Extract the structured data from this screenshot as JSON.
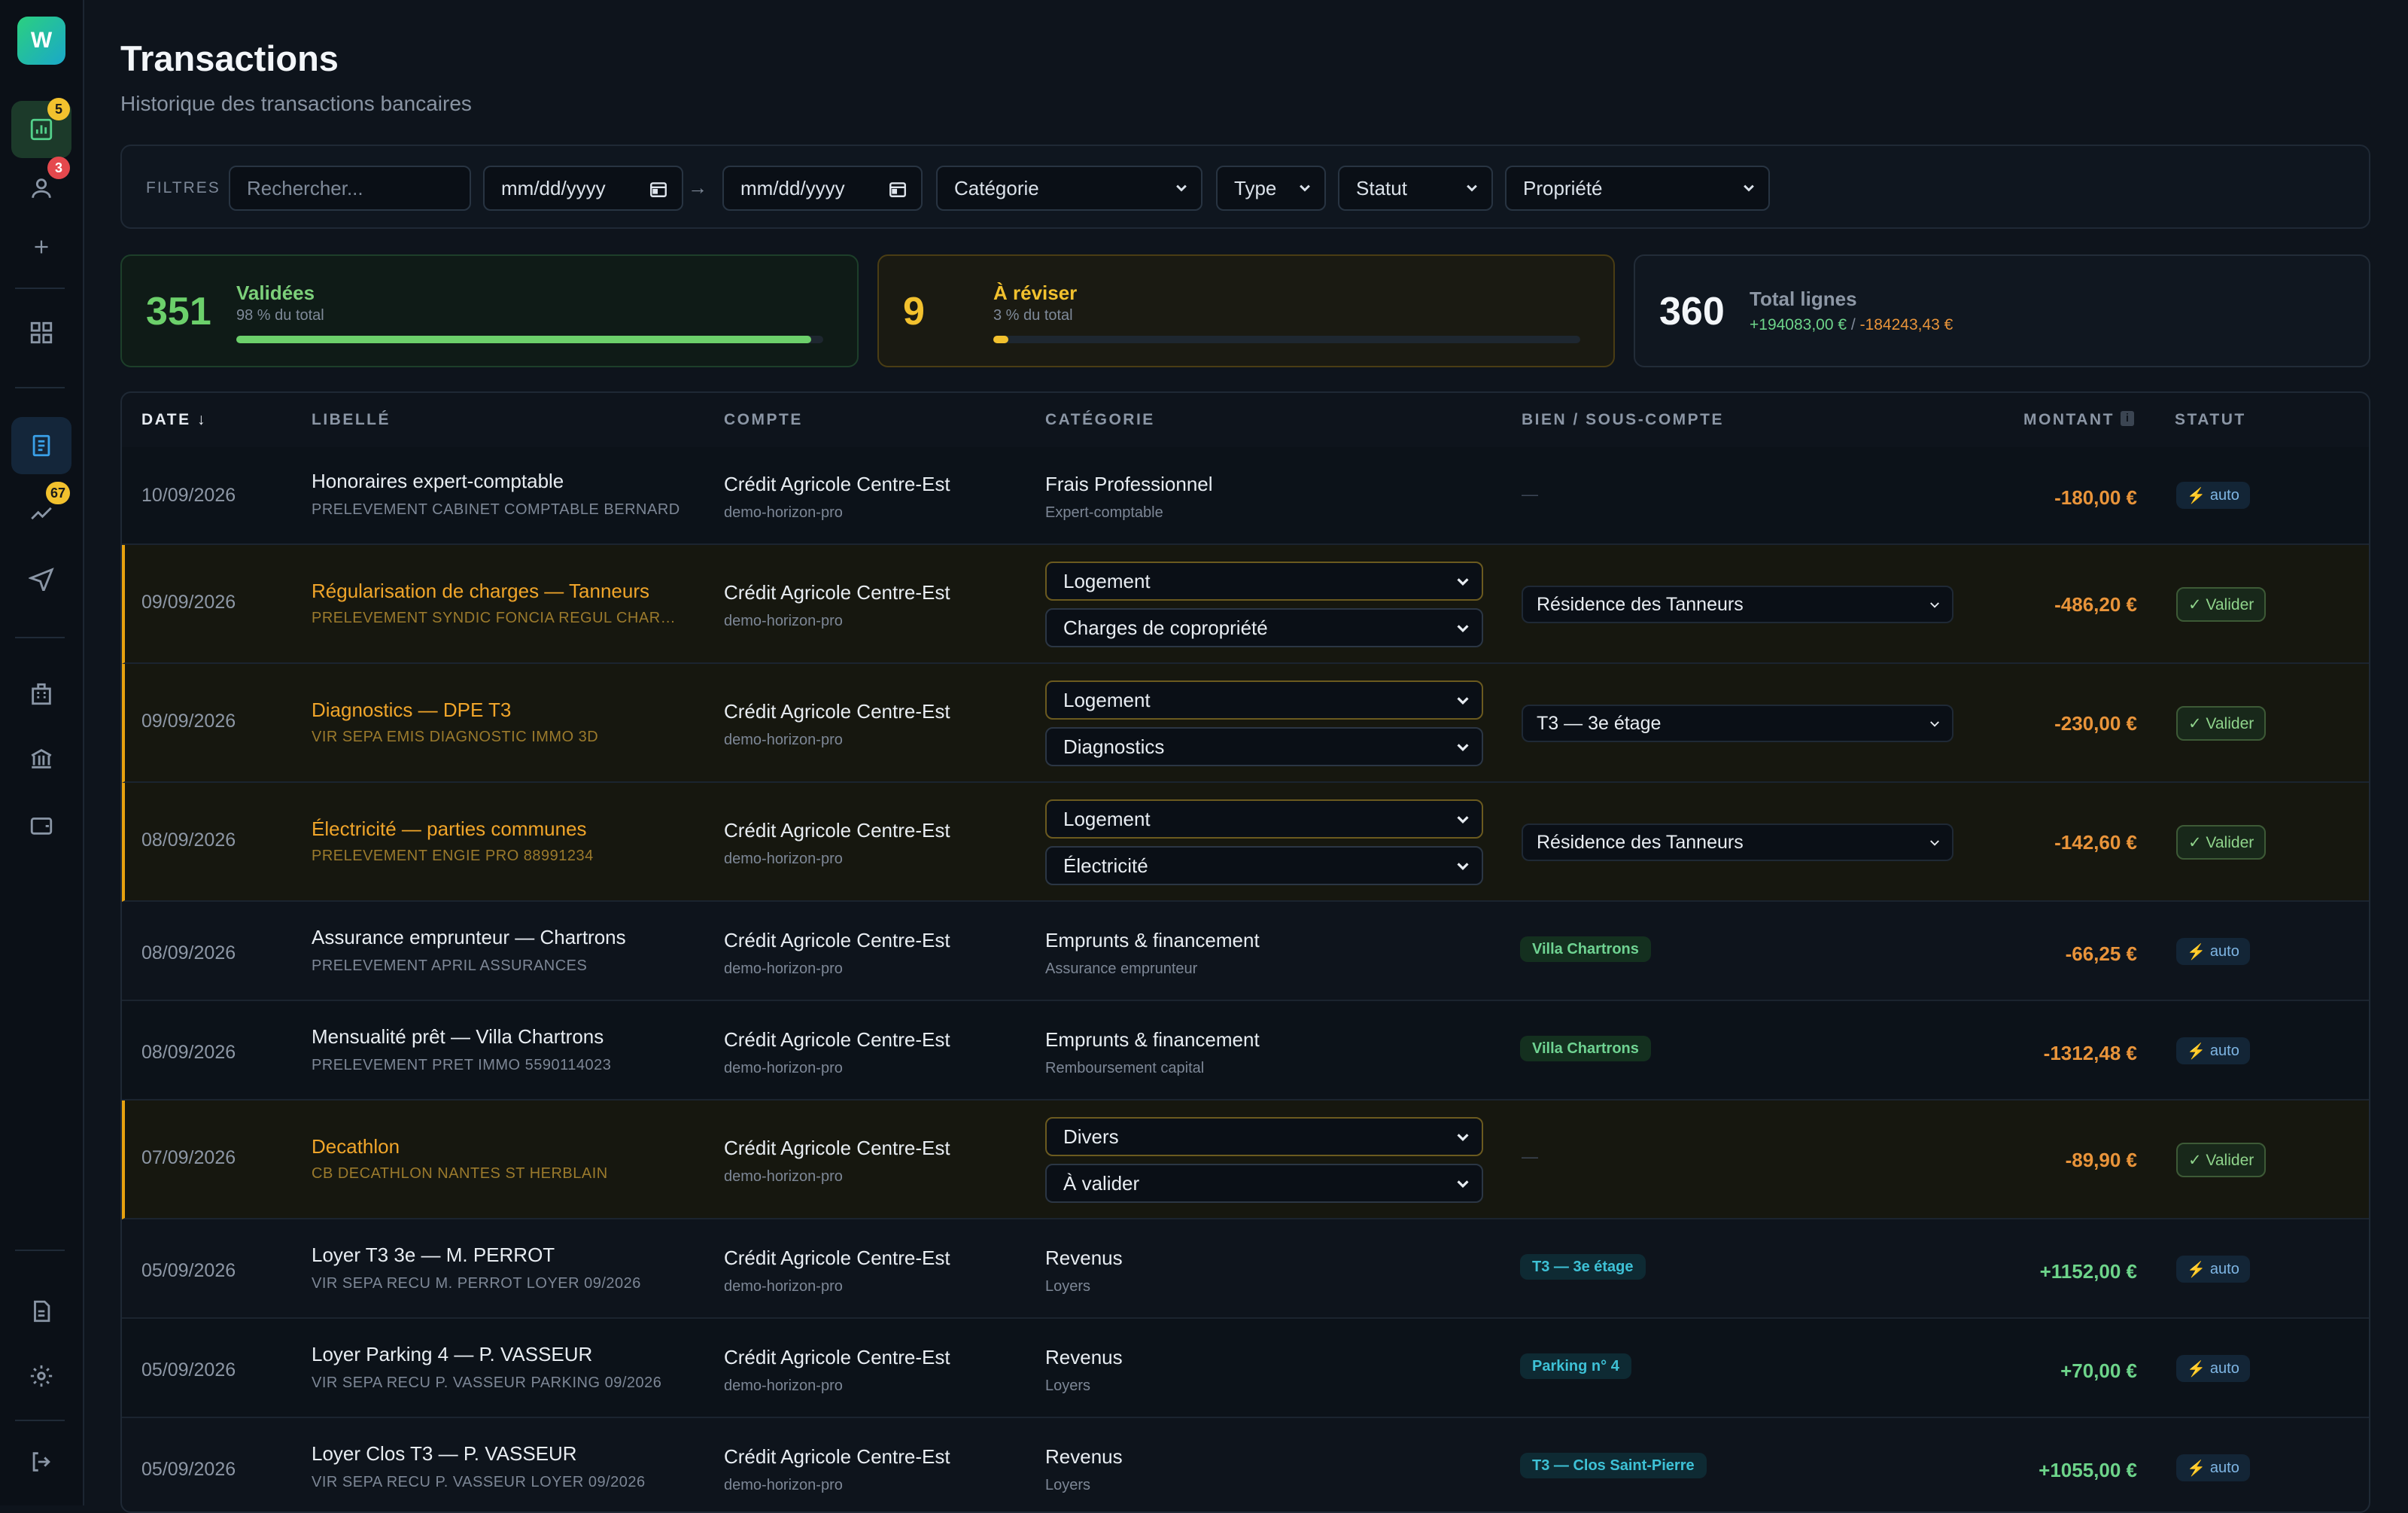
{
  "app": {
    "logo_letter": "W"
  },
  "sidebar": {
    "badges": {
      "dashboard": "5",
      "users": "3",
      "loans": "67"
    }
  },
  "header": {
    "title": "Transactions",
    "subtitle": "Historique des transactions bancaires"
  },
  "filters": {
    "label": "FILTRES",
    "search_placeholder": "Rechercher...",
    "date_from": "mm/dd/yyyy",
    "date_to": "mm/dd/yyyy",
    "category": "Catégorie",
    "type": "Type",
    "status": "Statut",
    "property": "Propriété"
  },
  "stats": {
    "validated": {
      "count": "351",
      "title": "Validées",
      "sub": "98 % du total",
      "fraction": 0.98,
      "color": "#6cd06b"
    },
    "review": {
      "count": "9",
      "title": "À réviser",
      "sub": "3 % du total",
      "fraction": 0.025,
      "color": "#f2c12e"
    },
    "total": {
      "count": "360",
      "title": "Total lignes",
      "credit": "+194083,00 €",
      "sep": " / ",
      "debit": "-184243,43 €"
    }
  },
  "table": {
    "headers": {
      "date": "DATE ↓",
      "libelle": "LIBELLÉ",
      "compte": "COMPTE",
      "categorie": "CATÉGORIE",
      "bien": "BIEN / SOUS-COMPTE",
      "montant": "MONTANT",
      "statut": "STATUT"
    },
    "auto_label": "auto",
    "valider_label": "✓ Valider",
    "empty": "—",
    "rows": [
      {
        "date": "10/09/2026",
        "label": "Honoraires expert-comptable",
        "raw": "PRELEVEMENT CABINET COMPTABLE BERNARD",
        "account": "Crédit Agricole Centre-Est",
        "account_sub": "demo-horizon-pro",
        "category": "Frais Professionnel",
        "category_sub": "Expert-comptable",
        "amount": "-180,00 €"
      },
      {
        "date": "09/09/2026",
        "label": "Régularisation de charges — Tanneurs",
        "raw": "PRELEVEMENT SYNDIC FONCIA REGUL CHARGES",
        "account": "Crédit Agricole Centre-Est",
        "account_sub": "demo-horizon-pro",
        "category": "Logement",
        "category_sub": "Charges de copropriété",
        "property": "Résidence des Tanneurs",
        "amount": "-486,20 €"
      },
      {
        "date": "09/09/2026",
        "label": "Diagnostics — DPE T3",
        "raw": "VIR SEPA EMIS DIAGNOSTIC IMMO 3D",
        "account": "Crédit Agricole Centre-Est",
        "account_sub": "demo-horizon-pro",
        "category": "Logement",
        "category_sub": "Diagnostics",
        "property": "T3 — 3e étage",
        "amount": "-230,00 €"
      },
      {
        "date": "08/09/2026",
        "label": "Électricité — parties communes",
        "raw": "PRELEVEMENT ENGIE PRO 88991234",
        "account": "Crédit Agricole Centre-Est",
        "account_sub": "demo-horizon-pro",
        "category": "Logement",
        "category_sub": "Électricité",
        "property": "Résidence des Tanneurs",
        "amount": "-142,60 €"
      },
      {
        "date": "08/09/2026",
        "label": "Assurance emprunteur — Chartrons",
        "raw": "PRELEVEMENT APRIL ASSURANCES",
        "account": "Crédit Agricole Centre-Est",
        "account_sub": "demo-horizon-pro",
        "category": "Emprunts & financement",
        "category_sub": "Assurance emprunteur",
        "property": "Villa Chartrons",
        "amount": "-66,25 €"
      },
      {
        "date": "08/09/2026",
        "label": "Mensualité prêt — Villa Chartrons",
        "raw": "PRELEVEMENT PRET IMMO 5590114023",
        "account": "Crédit Agricole Centre-Est",
        "account_sub": "demo-horizon-pro",
        "category": "Emprunts & financement",
        "category_sub": "Remboursement capital",
        "property": "Villa Chartrons",
        "amount": "-1312,48 €"
      },
      {
        "date": "07/09/2026",
        "label": "Decathlon",
        "raw": "CB DECATHLON NANTES ST HERBLAIN",
        "account": "Crédit Agricole Centre-Est",
        "account_sub": "demo-horizon-pro",
        "category": "Divers",
        "category_sub": "À valider",
        "amount": "-89,90 €"
      },
      {
        "date": "05/09/2026",
        "label": "Loyer T3 3e — M. PERROT",
        "raw": "VIR SEPA RECU M. PERROT LOYER 09/2026",
        "account": "Crédit Agricole Centre-Est",
        "account_sub": "demo-horizon-pro",
        "category": "Revenus",
        "category_sub": "Loyers",
        "property": "T3 — 3e étage",
        "amount": "+1152,00 €"
      },
      {
        "date": "05/09/2026",
        "label": "Loyer Parking 4 — P. VASSEUR",
        "raw": "VIR SEPA RECU P. VASSEUR PARKING 09/2026",
        "account": "Crédit Agricole Centre-Est",
        "account_sub": "demo-horizon-pro",
        "category": "Revenus",
        "category_sub": "Loyers",
        "property": "Parking n° 4",
        "amount": "+70,00 €"
      },
      {
        "date": "05/09/2026",
        "label": "Loyer Clos T3 — P. VASSEUR",
        "raw": "VIR SEPA RECU P. VASSEUR LOYER 09/2026",
        "account": "Crédit Agricole Centre-Est",
        "account_sub": "demo-horizon-pro",
        "category": "Revenus",
        "category_sub": "Loyers",
        "property": "T3 — Clos Saint-Pierre",
        "amount": "+1055,00 €"
      }
    ]
  }
}
